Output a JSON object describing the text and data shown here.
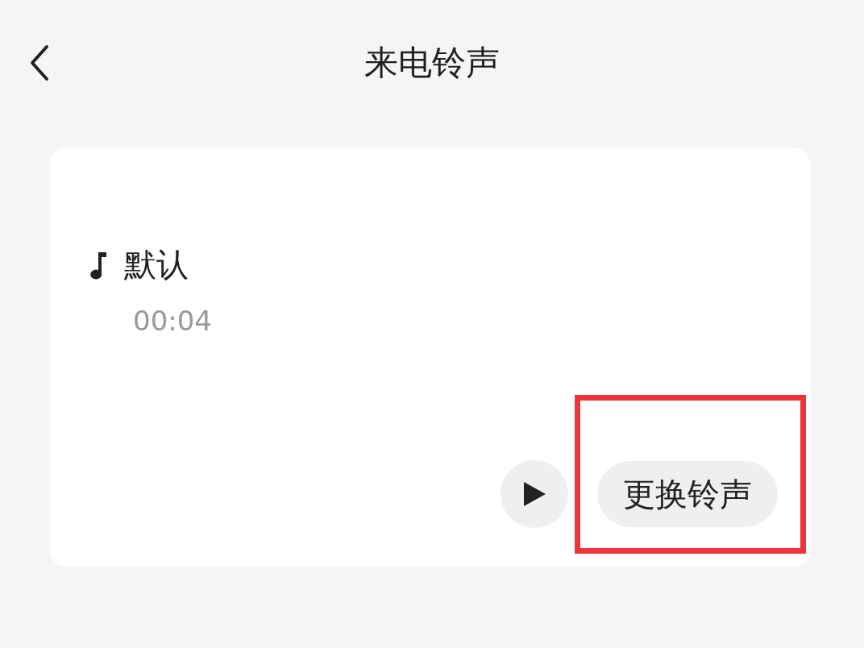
{
  "header": {
    "title": "来电铃声"
  },
  "ringtone": {
    "name": "默认",
    "duration": "00:04"
  },
  "actions": {
    "change_label": "更换铃声"
  },
  "annotation": {
    "kind": "highlight-box",
    "color": "#f2333c"
  }
}
